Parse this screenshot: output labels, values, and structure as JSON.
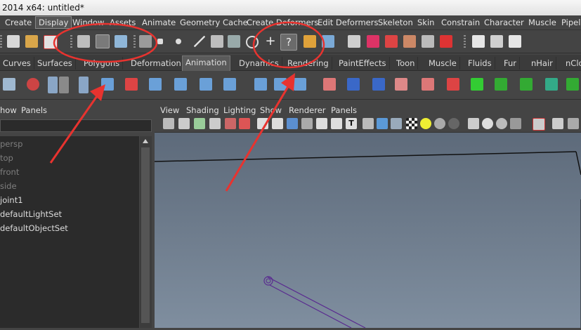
{
  "window": {
    "title": "2014 x64: untitled*"
  },
  "menubar": {
    "items": [
      "Create",
      "Display",
      "Window",
      "Assets",
      "Animate",
      "Geometry Cache",
      "Create Deformers",
      "Edit Deformers",
      "Skeleton",
      "Skin",
      "Constrain",
      "Character",
      "Muscle",
      "Pipeline"
    ],
    "selected": "Display"
  },
  "statusline": {
    "icons": [
      "grid-select-icon",
      "open-folder-icon",
      "pdf-save-icon",
      "select-hierarchy-icon",
      "select-object-icon",
      "select-component-icon",
      "filter-icon",
      "square-icon",
      "circle-icon",
      "line-icon",
      "snap-grid-icon",
      "snap-curve-icon",
      "snap-point-icon",
      "plus-icon",
      "help-question-icon",
      "lock-icon",
      "select-by-type-icon",
      "history-icon",
      "camera-icon",
      "magnet-icon",
      "render-icon",
      "render-settings-icon",
      "ipr-icon"
    ]
  },
  "shelf_tabs": {
    "items": [
      "Curves",
      "Surfaces",
      "Polygons",
      "Deformation",
      "Animation",
      "Dynamics",
      "Rendering",
      "PaintEffects",
      "Toon",
      "Muscle",
      "Fluids",
      "Fur",
      "nHair",
      "nClo"
    ],
    "active": "Animation"
  },
  "shelf": {
    "icons": [
      "motion-path-icon",
      "ik-handle-icon",
      "human-body-icon",
      "character-icon",
      "joint-icon",
      "ik-spline-icon",
      "mirror-joint-icon",
      "orient-joint-icon",
      "insert-joint-icon",
      "reroot-icon",
      "disconnect-icon",
      "connect-icon",
      "bind-skin-icon",
      "head-icon",
      "paint-weights-icon",
      "locator-icon",
      "cluster-icon",
      "lattice-icon",
      "bend-icon"
    ]
  },
  "outliner": {
    "menu": [
      "how",
      "Panels"
    ],
    "items": [
      {
        "label": "persp",
        "dim": true
      },
      {
        "label": "top",
        "dim": true
      },
      {
        "label": "front",
        "dim": true
      },
      {
        "label": "side",
        "dim": true
      },
      {
        "label": "joint1",
        "dim": false
      },
      {
        "label": "defaultLightSet",
        "dim": false
      },
      {
        "label": "defaultObjectSet",
        "dim": false
      }
    ]
  },
  "viewport": {
    "menu": [
      "View",
      "Shading",
      "Lighting",
      "Show",
      "Renderer",
      "Panels"
    ],
    "toolbar_icons": [
      "camera-attributes-icon",
      "bookmark-icon",
      "film-gate-icon",
      "resolution-gate-icon",
      "safe-action-icon",
      "grid-toggle-icon",
      "wireframe-icon",
      "smooth-shade-icon",
      "flat-shade-icon",
      "xray-icon",
      "bounding-box-icon",
      "text-icon",
      "default-material-icon",
      "cube-wire-icon",
      "cube-shaded-icon",
      "cube-textured-icon",
      "checker-icon",
      "light-icon",
      "sphere-shaded-icon",
      "sphere-dark-icon",
      "ambient-occlusion-icon",
      "shadow-icon",
      "motion-blur-icon",
      "isolate-select-icon",
      "cube-small-icon",
      "two-pane-icon"
    ]
  },
  "colors": {
    "annotation": "#e8332f",
    "background": "#444444",
    "viewport_top": "#5d6a7a",
    "viewport_bottom": "#7f8e9f",
    "joint_wire": "#5a2b90"
  }
}
